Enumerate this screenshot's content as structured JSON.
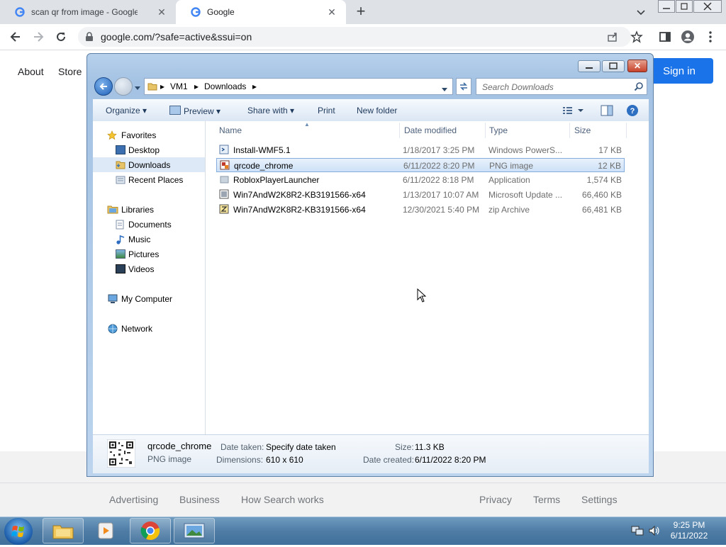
{
  "browser": {
    "tabs": [
      {
        "title": "scan qr from image - Google Sea",
        "active": false
      },
      {
        "title": "Google",
        "active": true
      }
    ],
    "new_tab_symbol": "+",
    "address": "google.com/?safe=active&ssui=on"
  },
  "google": {
    "top_links": [
      "About",
      "Store"
    ],
    "sign_in": "Sign in",
    "footer_left": [
      "Advertising",
      "Business",
      "How Search works"
    ],
    "footer_right": [
      "Privacy",
      "Terms",
      "Settings"
    ],
    "brand_color": "#1a73e8"
  },
  "explorer": {
    "breadcrumb": [
      "VM1",
      "Downloads"
    ],
    "search_placeholder": "Search Downloads",
    "commands": [
      "Organize",
      "Preview",
      "Share with",
      "Print",
      "New folder"
    ],
    "nav": {
      "favorites": {
        "label": "Favorites",
        "items": [
          "Desktop",
          "Downloads",
          "Recent Places"
        ]
      },
      "libraries": {
        "label": "Libraries",
        "items": [
          "Documents",
          "Music",
          "Pictures",
          "Videos"
        ]
      },
      "computer": "My Computer",
      "network": "Network",
      "selected": "Downloads"
    },
    "columns": [
      "Name",
      "Date modified",
      "Type",
      "Size"
    ],
    "files": [
      {
        "name": "Install-WMF5.1",
        "date": "1/18/2017 3:25 PM",
        "type": "Windows PowerS...",
        "size": "17 KB",
        "icon": "script-icon"
      },
      {
        "name": "qrcode_chrome",
        "date": "6/11/2022 8:20 PM",
        "type": "PNG image",
        "size": "12 KB",
        "icon": "image-icon",
        "selected": true
      },
      {
        "name": "RobloxPlayerLauncher",
        "date": "6/11/2022 8:18 PM",
        "type": "Application",
        "size": "1,574 KB",
        "icon": "app-icon"
      },
      {
        "name": "Win7AndW2K8R2-KB3191566-x64",
        "date": "1/13/2017 10:07 AM",
        "type": "Microsoft Update ...",
        "size": "66,460 KB",
        "icon": "update-icon"
      },
      {
        "name": "Win7AndW2K8R2-KB3191566-x64",
        "date": "12/30/2021 5:40 PM",
        "type": "zip Archive",
        "size": "66,481 KB",
        "icon": "zip-icon"
      }
    ],
    "details": {
      "name": "qrcode_chrome",
      "kind": "PNG image",
      "date_taken_label": "Date taken:",
      "date_taken": "Specify date taken",
      "dimensions_label": "Dimensions:",
      "dimensions": "610 x 610",
      "size_label": "Size:",
      "size": "11.3 KB",
      "date_created_label": "Date created:",
      "date_created": "6/11/2022 8:20 PM"
    }
  },
  "taskbar": {
    "time": "9:25 PM",
    "date": "6/11/2022",
    "apps": [
      "file-explorer-icon",
      "media-player-icon",
      "chrome-icon",
      "image-viewer-icon"
    ]
  }
}
